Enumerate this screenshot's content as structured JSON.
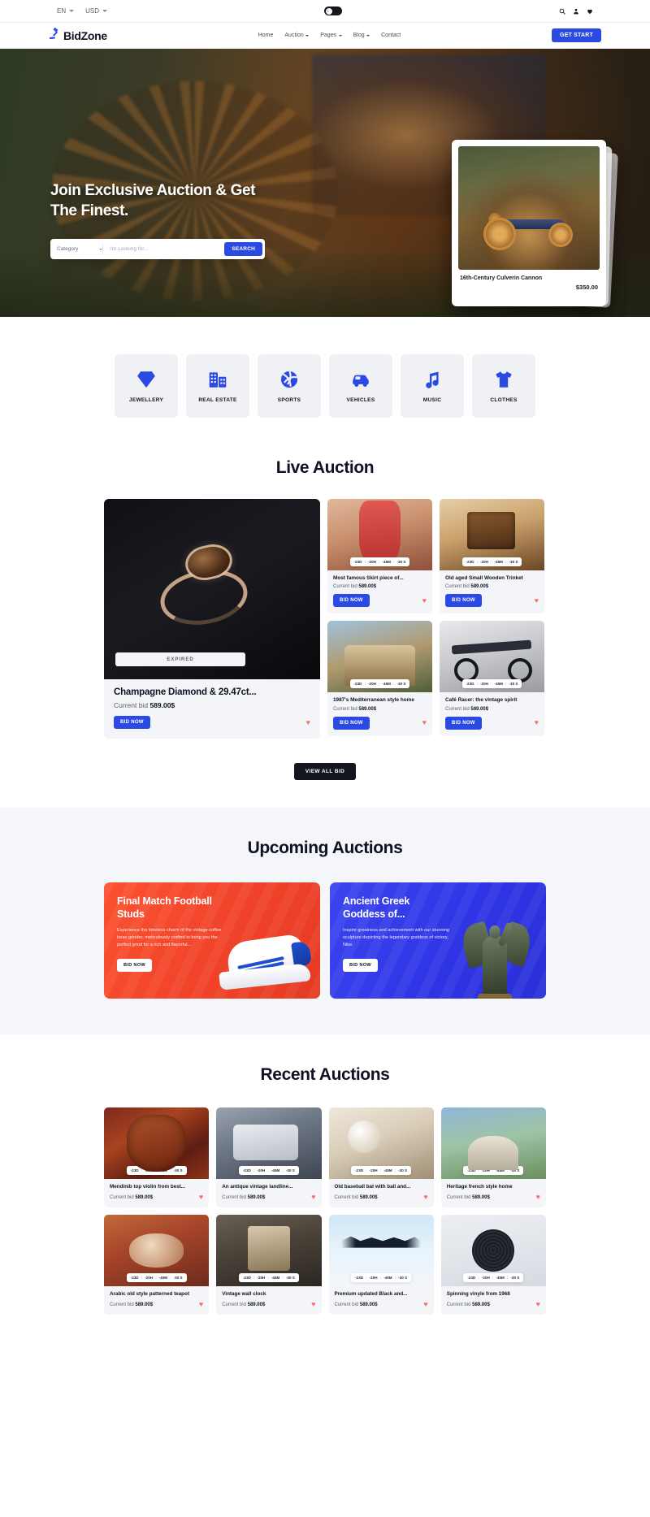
{
  "topbar": {
    "language": "EN",
    "currency": "USD",
    "theme_toggle_icon": "moon-icon",
    "icons": [
      "search-icon",
      "user-icon",
      "heart-icon"
    ]
  },
  "navbar": {
    "logo_text": "BidZone",
    "logo_icon": "gavel-icon",
    "menu": [
      {
        "label": "Home",
        "has_dropdown": false
      },
      {
        "label": "Auction",
        "has_dropdown": true
      },
      {
        "label": "Pages",
        "has_dropdown": true
      },
      {
        "label": "Blog",
        "has_dropdown": true
      },
      {
        "label": "Contact",
        "has_dropdown": false
      }
    ],
    "cta_label": "GET START"
  },
  "hero": {
    "title_line1": "Join Exclusive Auction & Get",
    "title_line2": "The Finest.",
    "search": {
      "category_label": "Category",
      "input_placeholder": "I'm Looking for...",
      "button_label": "SEARCH"
    },
    "card": {
      "name": "16th-Century Culverin Cannon",
      "price": "$350.00"
    }
  },
  "categories": {
    "items": [
      {
        "label": "JEWELLERY",
        "icon": "diamond-icon"
      },
      {
        "label": "REAL ESTATE",
        "icon": "building-icon"
      },
      {
        "label": "SPORTS",
        "icon": "volleyball-icon"
      },
      {
        "label": "VEHICLES",
        "icon": "car-icon"
      },
      {
        "label": "MUSIC",
        "icon": "music-note-icon"
      },
      {
        "label": "CLOTHES",
        "icon": "tshirt-icon"
      }
    ]
  },
  "live_auction": {
    "title": "Live Auction",
    "featured": {
      "status": "EXPIRED",
      "name": "Champagne Diamond & 29.47ct...",
      "bid_label": "Current bid",
      "bid_value": "589.00$",
      "bid_button": "BID NOW"
    },
    "timer": {
      "days": "-23D",
      "hours": "-20H",
      "minutes": "-45M",
      "seconds": "-30 S",
      "sep": ":"
    },
    "cards": [
      {
        "name": "Most famous Skirt piece of...",
        "bid_label": "Current bid",
        "bid_value": "589.00$",
        "bid_button": "BID NOW"
      },
      {
        "name": "Old aged Small Wooden Trinket",
        "bid_label": "Current bid",
        "bid_value": "589.00$",
        "bid_button": "BID NOW"
      },
      {
        "name": "1987's Mediterranean style home",
        "bid_label": "Current bid",
        "bid_value": "589.00$",
        "bid_button": "BID NOW"
      },
      {
        "name": "Café Racer: the vintage spirit",
        "bid_label": "Current bid",
        "bid_value": "589.00$",
        "bid_button": "BID NOW"
      }
    ],
    "view_all_label": "VIEW ALL BID"
  },
  "upcoming": {
    "title": "Upcoming Auctions",
    "cards": [
      {
        "title": "Final Match Football Studs",
        "desc": "Experience the timeless charm of the vintage coffee bean grinder, meticulously crafted to bring you the perfect grind for a rich and flavorful...",
        "button": "BID NOW"
      },
      {
        "title": "Ancient Greek Goddess of...",
        "desc": "Inspire greatness and achievement with our stunning sculpture depicting the legendary goddess of victory, Nike.",
        "button": "BID NOW"
      }
    ]
  },
  "recent": {
    "title": "Recent Auctions",
    "timer": {
      "days": "-23D",
      "hours": "-20H",
      "minutes": "-45M",
      "seconds": "-30 S",
      "sep": ":"
    },
    "items": [
      {
        "name": "Mendinib top violin from best...",
        "bid_label": "Current bid",
        "bid_value": "589.00$",
        "texture": "tx-violin"
      },
      {
        "name": "An antique vintage landline...",
        "bid_label": "Current bid",
        "bid_value": "589.00$",
        "texture": "tx-landline"
      },
      {
        "name": "Old baseball bat with ball and...",
        "bid_label": "Current bid",
        "bid_value": "589.00$",
        "texture": "tx-baseball"
      },
      {
        "name": "Heritage french style home",
        "bid_label": "Current bid",
        "bid_value": "589.00$",
        "texture": "tx-heritage"
      },
      {
        "name": "Arabic old style patterned teapot",
        "bid_label": "Current bid",
        "bid_value": "589.00$",
        "texture": "tx-teapot"
      },
      {
        "name": "Vintage wall clock",
        "bid_label": "Current bid",
        "bid_value": "589.00$",
        "texture": "tx-clock"
      },
      {
        "name": "Premium updated Black and...",
        "bid_label": "Current bid",
        "bid_value": "589.00$",
        "texture": "tx-black"
      },
      {
        "name": "Spinning vinyle from 1968",
        "bid_label": "Current bid",
        "bid_value": "589.00$",
        "texture": "tx-vinyl"
      }
    ]
  },
  "colors": {
    "accent": "#2b4ae4",
    "dark": "#13151f",
    "red_card": "#fc5130",
    "blue_card": "#3b45ef",
    "heart": "#ff6b6b",
    "panel": "#f4f5f8"
  }
}
